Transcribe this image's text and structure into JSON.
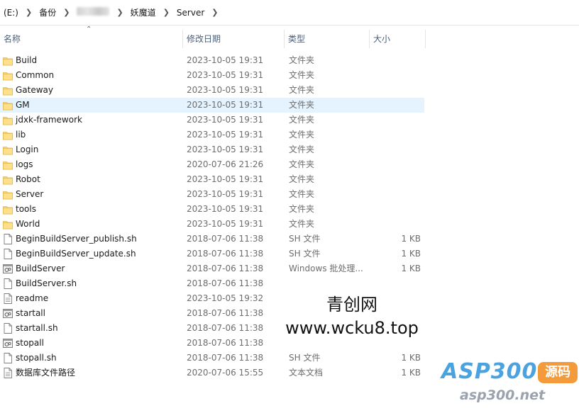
{
  "breadcrumb": {
    "drive": "(E:)",
    "items": [
      "备份",
      "",
      "妖魔道",
      "Server"
    ]
  },
  "columns": {
    "name": "名称",
    "date": "修改日期",
    "type": "类型",
    "size": "大小"
  },
  "files": [
    {
      "name": "Build",
      "date": "2023-10-05 19:31",
      "type": "文件夹",
      "size": "",
      "icon": "folder-icon"
    },
    {
      "name": "Common",
      "date": "2023-10-05 19:31",
      "type": "文件夹",
      "size": "",
      "icon": "folder-icon"
    },
    {
      "name": "Gateway",
      "date": "2023-10-05 19:31",
      "type": "文件夹",
      "size": "",
      "icon": "folder-icon"
    },
    {
      "name": "GM",
      "date": "2023-10-05 19:31",
      "type": "文件夹",
      "size": "",
      "icon": "folder-icon",
      "selected": true
    },
    {
      "name": "jdxk-framework",
      "date": "2023-10-05 19:31",
      "type": "文件夹",
      "size": "",
      "icon": "folder-icon"
    },
    {
      "name": "lib",
      "date": "2023-10-05 19:31",
      "type": "文件夹",
      "size": "",
      "icon": "folder-icon"
    },
    {
      "name": "Login",
      "date": "2023-10-05 19:31",
      "type": "文件夹",
      "size": "",
      "icon": "folder-icon"
    },
    {
      "name": "logs",
      "date": "2020-07-06 21:26",
      "type": "文件夹",
      "size": "",
      "icon": "folder-icon"
    },
    {
      "name": "Robot",
      "date": "2023-10-05 19:31",
      "type": "文件夹",
      "size": "",
      "icon": "folder-icon"
    },
    {
      "name": "Server",
      "date": "2023-10-05 19:31",
      "type": "文件夹",
      "size": "",
      "icon": "folder-icon"
    },
    {
      "name": "tools",
      "date": "2023-10-05 19:31",
      "type": "文件夹",
      "size": "",
      "icon": "folder-icon"
    },
    {
      "name": "World",
      "date": "2023-10-05 19:31",
      "type": "文件夹",
      "size": "",
      "icon": "folder-icon"
    },
    {
      "name": "BeginBuildServer_publish.sh",
      "date": "2018-07-06 11:38",
      "type": "SH 文件",
      "size": "1 KB",
      "icon": "file-icon"
    },
    {
      "name": "BeginBuildServer_update.sh",
      "date": "2018-07-06 11:38",
      "type": "SH 文件",
      "size": "1 KB",
      "icon": "file-icon"
    },
    {
      "name": "BuildServer",
      "date": "2018-07-06 11:38",
      "type": "Windows 批处理...",
      "size": "1 KB",
      "icon": "batch-file-icon"
    },
    {
      "name": "BuildServer.sh",
      "date": "2018-07-06 11:38",
      "type": "",
      "size": "",
      "icon": "file-icon"
    },
    {
      "name": "readme",
      "date": "2023-10-05 19:32",
      "type": "",
      "size": "",
      "icon": "text-file-icon"
    },
    {
      "name": "startall",
      "date": "2018-07-06 11:38",
      "type": "",
      "size": "",
      "icon": "batch-file-icon"
    },
    {
      "name": "startall.sh",
      "date": "2018-07-06 11:38",
      "type": "",
      "size": "",
      "icon": "file-icon"
    },
    {
      "name": "stopall",
      "date": "2018-07-06 11:38",
      "type": "",
      "size": "",
      "icon": "batch-file-icon"
    },
    {
      "name": "stopall.sh",
      "date": "2018-07-06 11:38",
      "type": "SH 文件",
      "size": "1 KB",
      "icon": "file-icon"
    },
    {
      "name": "数据库文件路径",
      "date": "2020-07-06 15:55",
      "type": "文本文档",
      "size": "1 KB",
      "icon": "text-file-icon"
    }
  ],
  "watermark": {
    "line1": "青创网",
    "line2": "www.wcku8.top"
  },
  "logo": {
    "main": "ASP300",
    "tag": "源码",
    "url": "asp300.net"
  },
  "colors": {
    "folder": "#f8d775",
    "selected_row": "#e5f3ff",
    "header_text": "#4c607a",
    "logo_blue": "#4aa3e0",
    "logo_orange": "#f39a3b"
  }
}
